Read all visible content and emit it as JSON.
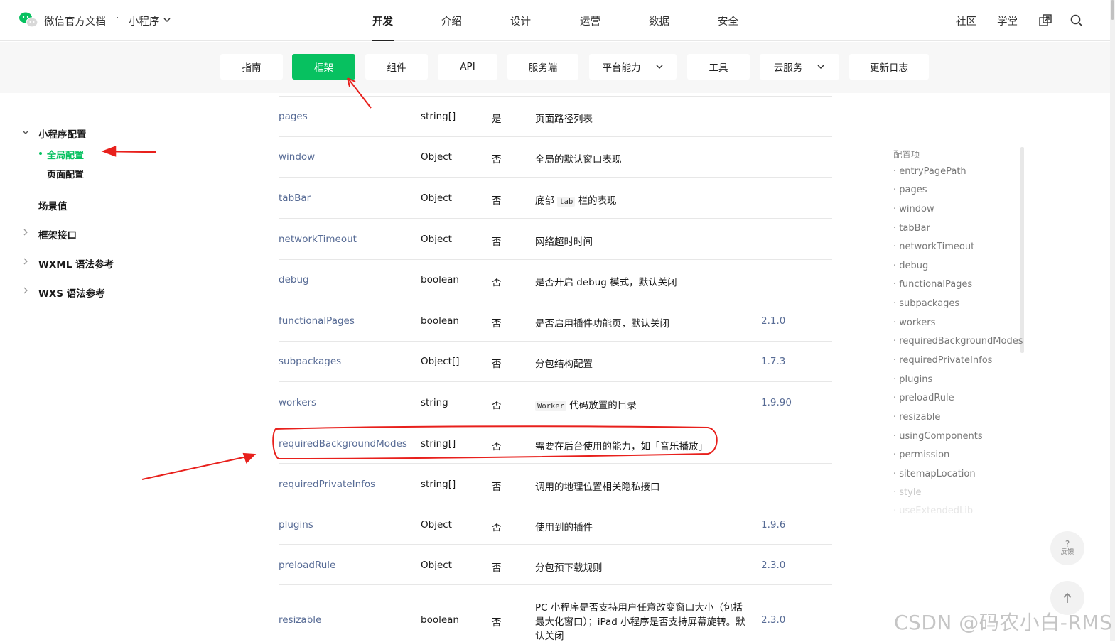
{
  "header": {
    "brand": "微信官方文档",
    "separator": "·",
    "product": "小程序",
    "nav": [
      "开发",
      "介绍",
      "设计",
      "运营",
      "数据",
      "安全"
    ],
    "active_nav": "开发",
    "right_nav": [
      "社区",
      "学堂"
    ],
    "icons": [
      "wechat-logo-icon",
      "chevron-down-icon",
      "external-link-icon",
      "search-icon"
    ]
  },
  "subnav": {
    "tabs": [
      {
        "label": "指南"
      },
      {
        "label": "框架",
        "active": true
      },
      {
        "label": "组件"
      },
      {
        "label": "API"
      },
      {
        "label": "服务端"
      },
      {
        "label": "平台能力",
        "has_dropdown": true
      },
      {
        "label": "工具"
      },
      {
        "label": "云服务",
        "has_dropdown": true
      },
      {
        "label": "更新日志"
      }
    ]
  },
  "sidebar": {
    "groups": [
      {
        "label": "小程序配置",
        "expanded": true,
        "children": [
          {
            "label": "全局配置",
            "active": true
          },
          {
            "label": "页面配置"
          }
        ]
      },
      {
        "label": "场景值"
      },
      {
        "label": "框架接口"
      },
      {
        "label": "WXML 语法参考"
      },
      {
        "label": "WXS 语法参考"
      }
    ]
  },
  "table": {
    "rows": [
      {
        "prop": "pages",
        "type": "string[]",
        "required": "是",
        "desc": "页面路径列表",
        "version": ""
      },
      {
        "prop": "window",
        "type": "Object",
        "required": "否",
        "desc": "全局的默认窗口表现",
        "version": ""
      },
      {
        "prop": "tabBar",
        "type": "Object",
        "required": "否",
        "desc_pre": "底部",
        "desc_code": "tab",
        "desc_post": "栏的表现",
        "version": ""
      },
      {
        "prop": "networkTimeout",
        "type": "Object",
        "required": "否",
        "desc": "网络超时时间",
        "version": ""
      },
      {
        "prop": "debug",
        "type": "boolean",
        "required": "否",
        "desc": "是否开启 debug 模式，默认关闭",
        "version": ""
      },
      {
        "prop": "functionalPages",
        "type": "boolean",
        "required": "否",
        "desc": "是否启用插件功能页，默认关闭",
        "version": "2.1.0"
      },
      {
        "prop": "subpackages",
        "type": "Object[]",
        "required": "否",
        "desc": "分包结构配置",
        "version": "1.7.3"
      },
      {
        "prop": "workers",
        "type": "string",
        "required": "否",
        "desc_code": "Worker",
        "desc_post": "代码放置的目录",
        "version": "1.9.90"
      },
      {
        "prop": "requiredBackgroundModes",
        "type": "string[]",
        "required": "否",
        "desc": "需要在后台使用的能力，如「音乐播放」",
        "version": ""
      },
      {
        "prop": "requiredPrivateInfos",
        "type": "string[]",
        "required": "否",
        "desc": "调用的地理位置相关隐私接口",
        "version": ""
      },
      {
        "prop": "plugins",
        "type": "Object",
        "required": "否",
        "desc": "使用到的插件",
        "version": "1.9.6"
      },
      {
        "prop": "preloadRule",
        "type": "Object",
        "required": "否",
        "desc": "分包预下载规则",
        "version": "2.3.0"
      },
      {
        "prop": "resizable",
        "type": "boolean",
        "required": "否",
        "desc_lines": [
          "PC 小程序是否支持用户任意改变窗口大小（包括",
          "最大化窗口）；iPad 小程序是否支持屏幕旋转。默",
          "认关闭"
        ],
        "version": "2.3.0"
      }
    ]
  },
  "toc": {
    "title": "配置项",
    "items": [
      "entryPagePath",
      "pages",
      "window",
      "tabBar",
      "networkTimeout",
      "debug",
      "functionalPages",
      "subpackages",
      "workers",
      "requiredBackgroundModes",
      "requiredPrivateInfos",
      "plugins",
      "preloadRule",
      "resizable",
      "usingComponents",
      "permission",
      "sitemapLocation",
      "style",
      "useExtendedLib"
    ]
  },
  "floating": {
    "feedback_q": "?",
    "feedback_label": "反馈",
    "back_to_top_icon": "arrow-up-icon"
  },
  "watermark": "CSDN @码农小白-RMS",
  "colors": {
    "accent": "#07c160",
    "link": "#576b95",
    "annotation": "#e8201c"
  }
}
